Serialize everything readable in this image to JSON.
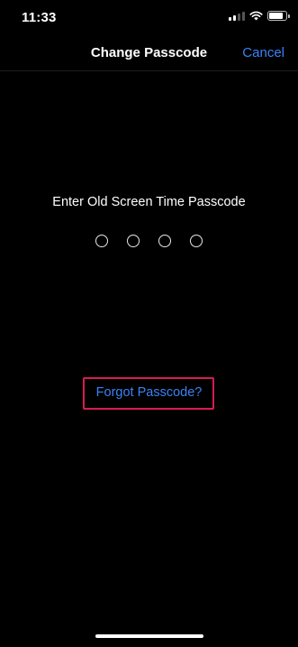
{
  "status_bar": {
    "time": "11:33",
    "icons": [
      "cellular-signal-icon",
      "wifi-icon",
      "battery-icon"
    ]
  },
  "nav": {
    "title": "Change Passcode",
    "cancel_label": "Cancel"
  },
  "passcode": {
    "prompt": "Enter Old Screen Time Passcode",
    "digit_count": 4,
    "digits_entered": 0
  },
  "forgot_link": {
    "label": "Forgot Passcode?"
  },
  "colors": {
    "background": "#000000",
    "accent": "#3a82f7",
    "highlight_box": "#d81b54"
  }
}
